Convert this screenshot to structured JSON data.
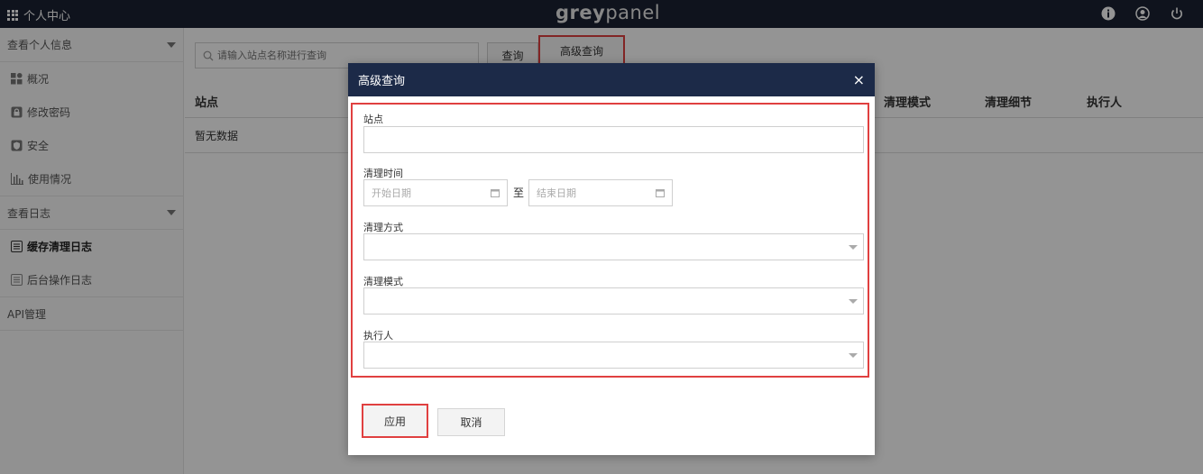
{
  "topbar": {
    "menu_label": "个人中心",
    "logo_left": "grey",
    "logo_right": "panel",
    "icons": [
      "info-icon",
      "user-icon",
      "power-icon"
    ]
  },
  "sidebar": {
    "section1": "查看个人信息",
    "items1": [
      {
        "label": "概况",
        "icon": "dashboard-icon"
      },
      {
        "label": "修改密码",
        "icon": "lock-icon"
      },
      {
        "label": "安全",
        "icon": "shield-icon"
      },
      {
        "label": "使用情况",
        "icon": "bar-chart-icon"
      }
    ],
    "section2": "查看日志",
    "items2": [
      {
        "label": "缓存清理日志",
        "icon": "log-icon",
        "active": true
      },
      {
        "label": "后台操作日志",
        "icon": "log-icon",
        "active": false
      }
    ],
    "section3": "API管理"
  },
  "main": {
    "search_placeholder": "请输入站点名称进行查询",
    "query_button": "查询",
    "advanced_button": "高级查询",
    "columns": [
      "站点",
      "清理模式",
      "清理细节",
      "执行人"
    ],
    "empty_text": "暂无数据"
  },
  "modal": {
    "title": "高级查询",
    "close": "×",
    "site_label": "站点",
    "time_label": "清理时间",
    "start_placeholder": "开始日期",
    "to_text": "至",
    "end_placeholder": "结束日期",
    "method_label": "清理方式",
    "mode_label": "清理模式",
    "executor_label": "执行人",
    "apply_button": "应用",
    "cancel_button": "取消"
  },
  "colors": {
    "topbar": "#1a2232",
    "modal_header": "#1c2a48",
    "highlight": "#e04040"
  }
}
